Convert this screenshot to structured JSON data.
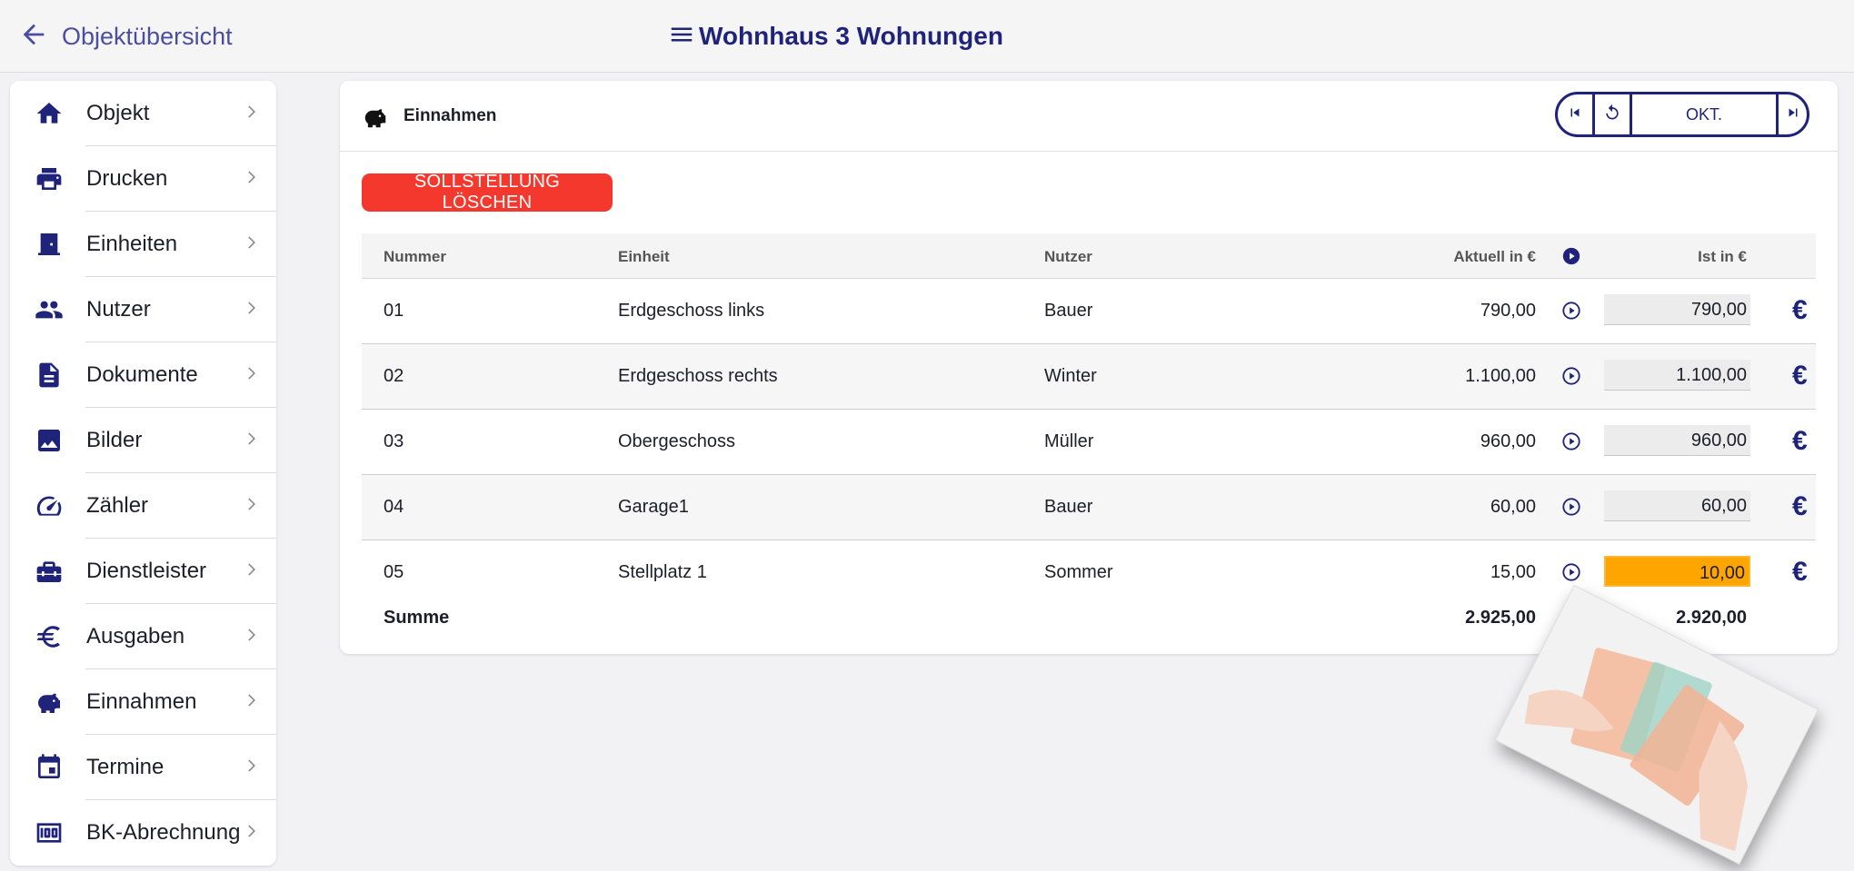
{
  "header": {
    "back_label": "Objektübersicht",
    "title": "Wohnhaus 3 Wohnungen"
  },
  "sidebar": {
    "items": [
      {
        "label": "Objekt",
        "icon": "home-icon"
      },
      {
        "label": "Drucken",
        "icon": "printer-icon"
      },
      {
        "label": "Einheiten",
        "icon": "door-icon"
      },
      {
        "label": "Nutzer",
        "icon": "people-icon"
      },
      {
        "label": "Dokumente",
        "icon": "document-icon"
      },
      {
        "label": "Bilder",
        "icon": "image-icon"
      },
      {
        "label": "Zähler",
        "icon": "gauge-icon"
      },
      {
        "label": "Dienstleister",
        "icon": "toolbox-icon"
      },
      {
        "label": "Ausgaben",
        "icon": "euro-icon"
      },
      {
        "label": "Einnahmen",
        "icon": "piggy-bank-icon"
      },
      {
        "label": "Termine",
        "icon": "calendar-icon"
      },
      {
        "label": "BK-Abrechnung",
        "icon": "money-icon"
      }
    ]
  },
  "main": {
    "card_title": "Einnahmen",
    "month_label": "OKT.",
    "delete_button": "SOLLSTELLUNG LÖSCHEN",
    "columns": {
      "nummer": "Nummer",
      "einheit": "Einheit",
      "nutzer": "Nutzer",
      "aktuell": "Aktuell in €",
      "ist": "Ist in €"
    },
    "rows": [
      {
        "nummer": "01",
        "einheit": "Erdgeschoss links",
        "nutzer": "Bauer",
        "aktuell": "790,00",
        "ist": "790,00"
      },
      {
        "nummer": "02",
        "einheit": "Erdgeschoss rechts",
        "nutzer": "Winter",
        "aktuell": "1.100,00",
        "ist": "1.100,00"
      },
      {
        "nummer": "03",
        "einheit": "Obergeschoss",
        "nutzer": "Müller",
        "aktuell": "960,00",
        "ist": "960,00"
      },
      {
        "nummer": "04",
        "einheit": "Garage1",
        "nutzer": "Bauer",
        "aktuell": "60,00",
        "ist": "60,00"
      },
      {
        "nummer": "05",
        "einheit": "Stellplatz 1",
        "nutzer": "Sommer",
        "aktuell": "15,00",
        "ist": "10,00"
      }
    ],
    "summe": {
      "label": "Summe",
      "aktuell": "2.925,00",
      "ist": "2.920,00"
    },
    "euro_symbol": "€"
  },
  "colors": {
    "primary": "#1f237a",
    "danger": "#f5382e",
    "highlight": "#ffa500"
  }
}
